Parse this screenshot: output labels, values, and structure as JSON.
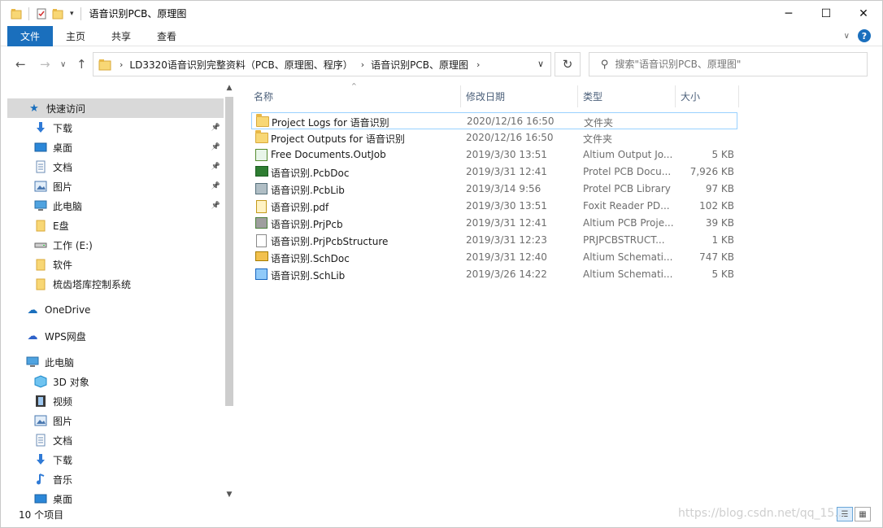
{
  "window": {
    "title": "语音识别PCB、原理图",
    "controls": {
      "minimize": "─",
      "maximize": "☐",
      "close": "✕"
    }
  },
  "ribbon": {
    "tabs": [
      "文件",
      "主页",
      "共享",
      "查看"
    ],
    "help": "?"
  },
  "address": {
    "crumbs": [
      "LD3320语音识别完整资料（PCB、原理图、程序）",
      "语音识别PCB、原理图"
    ],
    "search_placeholder": "搜索\"语音识别PCB、原理图\""
  },
  "nav": {
    "quick_access": "快速访问",
    "quick_items": [
      {
        "label": "下载",
        "icon": "download-arrow-icon",
        "pinned": true
      },
      {
        "label": "桌面",
        "icon": "desktop-icon",
        "pinned": true
      },
      {
        "label": "文档",
        "icon": "document-icon",
        "pinned": true
      },
      {
        "label": "图片",
        "icon": "pictures-icon",
        "pinned": true
      },
      {
        "label": "此电脑",
        "icon": "computer-icon",
        "pinned": true
      },
      {
        "label": "E盘",
        "icon": "folder-icon",
        "pinned": false
      },
      {
        "label": "工作 (E:)",
        "icon": "drive-icon",
        "pinned": false
      },
      {
        "label": "软件",
        "icon": "folder-icon",
        "pinned": false
      },
      {
        "label": "梳齿塔库控制系统",
        "icon": "folder-icon",
        "pinned": false
      }
    ],
    "onedrive": "OneDrive",
    "wps": "WPS网盘",
    "this_pc": "此电脑",
    "pc_items": [
      {
        "label": "3D 对象",
        "icon": "3d-objects-icon"
      },
      {
        "label": "视频",
        "icon": "video-icon"
      },
      {
        "label": "图片",
        "icon": "pictures-icon"
      },
      {
        "label": "文档",
        "icon": "document-icon"
      },
      {
        "label": "下载",
        "icon": "download-arrow-icon"
      },
      {
        "label": "音乐",
        "icon": "music-icon"
      },
      {
        "label": "桌面",
        "icon": "desktop-icon"
      }
    ]
  },
  "columns": {
    "name": "名称",
    "date": "修改日期",
    "type": "类型",
    "size": "大小"
  },
  "files": [
    {
      "name": "Project Logs for 语音识别",
      "date": "2020/12/16 16:50",
      "type": "文件夹",
      "size": "",
      "icon": "folder-icon"
    },
    {
      "name": "Project Outputs for 语音识别",
      "date": "2020/12/16 16:50",
      "type": "文件夹",
      "size": "",
      "icon": "folder-icon"
    },
    {
      "name": "Free Documents.OutJob",
      "date": "2019/3/30 13:51",
      "type": "Altium Output Jo...",
      "size": "5 KB",
      "icon": "outjob-icon"
    },
    {
      "name": "语音识别.PcbDoc",
      "date": "2019/3/31 12:41",
      "type": "Protel PCB Docu...",
      "size": "7,926 KB",
      "icon": "pcb-doc-icon"
    },
    {
      "name": "语音识别.PcbLib",
      "date": "2019/3/14 9:56",
      "type": "Protel PCB Library",
      "size": "97 KB",
      "icon": "pcb-lib-icon"
    },
    {
      "name": "语音识别.pdf",
      "date": "2019/3/30 13:51",
      "type": "Foxit Reader PD...",
      "size": "102 KB",
      "icon": "pdf-icon"
    },
    {
      "name": "语音识别.PrjPcb",
      "date": "2019/3/31 12:41",
      "type": "Altium PCB Proje...",
      "size": "39 KB",
      "icon": "prj-pcb-icon"
    },
    {
      "name": "语音识别.PrjPcbStructure",
      "date": "2019/3/31 12:23",
      "type": "PRJPCBSTRUCT...",
      "size": "1 KB",
      "icon": "blank-file-icon"
    },
    {
      "name": "语音识别.SchDoc",
      "date": "2019/3/31 12:40",
      "type": "Altium Schemati...",
      "size": "747 KB",
      "icon": "sch-doc-icon"
    },
    {
      "name": "语音识别.SchLib",
      "date": "2019/3/26 14:22",
      "type": "Altium Schemati...",
      "size": "5 KB",
      "icon": "sch-lib-icon"
    }
  ],
  "status": {
    "item_count": "10 个项目"
  },
  "watermark": "https://blog.csdn.net/qq_15..."
}
